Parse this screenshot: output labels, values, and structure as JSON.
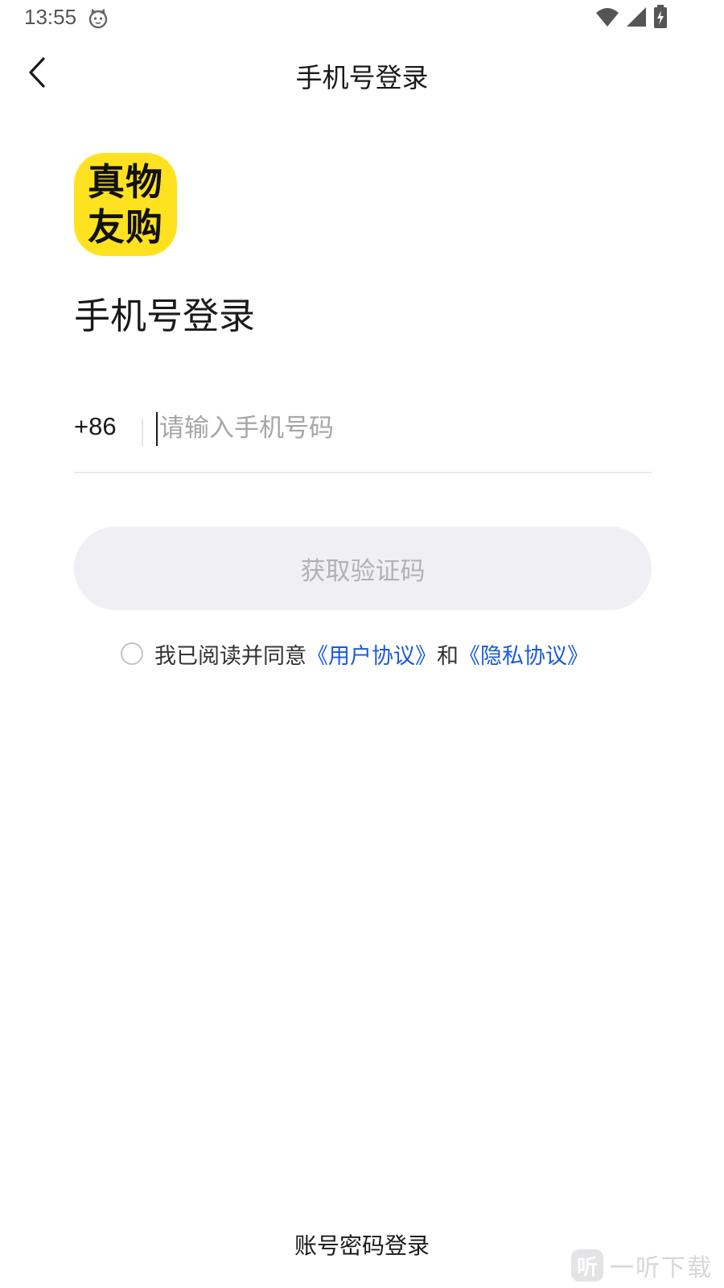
{
  "status_bar": {
    "time": "13:55",
    "icons": [
      "cat-face-icon",
      "wifi-icon",
      "cellular-signal-icon",
      "battery-charging-icon"
    ]
  },
  "nav": {
    "back_icon": "chevron-left-icon",
    "title": "手机号登录"
  },
  "logo": {
    "line1": "真物",
    "line2": "友购",
    "background": "#ffe21f"
  },
  "heading": "手机号登录",
  "phone": {
    "country_code": "+86",
    "value": "",
    "placeholder": "请输入手机号码"
  },
  "get_code_button": {
    "label": "获取验证码",
    "enabled": false
  },
  "agreement": {
    "checked": false,
    "prefix": "我已阅读并同意",
    "user_agreement": "《用户协议》",
    "conjunction": "和",
    "privacy_agreement": "《隐私协议》",
    "link_color": "#1b5bd6"
  },
  "footer": {
    "password_login": "账号密码登录"
  },
  "watermark": {
    "badge": "听",
    "text": "一听下载"
  }
}
